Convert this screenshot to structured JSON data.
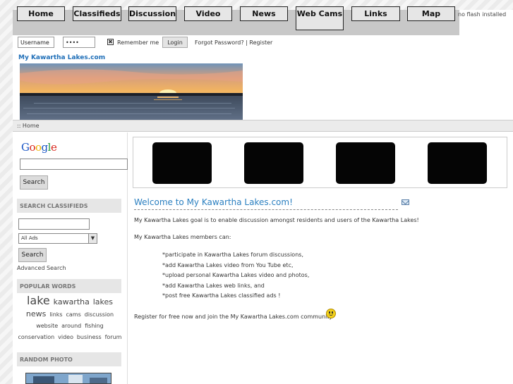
{
  "nav": {
    "items": [
      "Home",
      "Classifieds",
      "Discussion",
      "Video",
      "News",
      "Web Cams",
      "Links",
      "Map"
    ],
    "flash_note": "no flash installed"
  },
  "login": {
    "username_value": "Username",
    "password_value": "••••",
    "remember_label": "Remember me",
    "login_button": "Login",
    "forgot_register": "Forgot Password? | Register"
  },
  "site_title": "My Kawartha Lakes.com",
  "breadcrumb": ":: Home",
  "sidebar": {
    "google_logo": "Google",
    "search_button": "Search",
    "classifieds_heading": "SEARCH CLASSIFIEDS",
    "classifieds_select": "All Ads",
    "classifieds_button": "Search",
    "advanced_search": "Advanced Search",
    "popular_heading": "POPULAR WORDS",
    "popular_words": [
      {
        "word": "lake",
        "weight": 3
      },
      {
        "word": "kawartha",
        "weight": 2
      },
      {
        "word": "lakes",
        "weight": 2
      },
      {
        "word": "news",
        "weight": 2
      },
      {
        "word": "links",
        "weight": 1
      },
      {
        "word": "cams",
        "weight": 1
      },
      {
        "word": "discussion",
        "weight": 1
      },
      {
        "word": "website",
        "weight": 1
      },
      {
        "word": "around",
        "weight": 1
      },
      {
        "word": "fishing",
        "weight": 1
      },
      {
        "word": "conservation",
        "weight": 1
      },
      {
        "word": "video",
        "weight": 1
      },
      {
        "word": "business",
        "weight": 1
      },
      {
        "word": "forum",
        "weight": 1
      }
    ],
    "random_photo_heading": "RANDOM PHOTO"
  },
  "main": {
    "welcome_title": "Welcome to My Kawartha Lakes.com!",
    "intro": "My Kawartha Lakes goal is to enable discussion amongst residents and users of the Kawartha Lakes!",
    "members_can": "My Kawartha Lakes members can:",
    "bullets": [
      "*participate in Kawartha Lakes forum discussions,",
      "*add Kawartha Lakes video from You Tube etc,",
      "*upload personal Kawartha Lakes video and photos,",
      "*add Kawartha Lakes web links, and",
      "*post free Kawartha Lakes classified ads !"
    ],
    "register_line": "Register for free now and join the My Kawartha Lakes.com community"
  },
  "colors": {
    "accent_blue": "#2a7fc0",
    "nav_bar": "#c8c8c8",
    "nav_button": "#e6e6e6"
  }
}
